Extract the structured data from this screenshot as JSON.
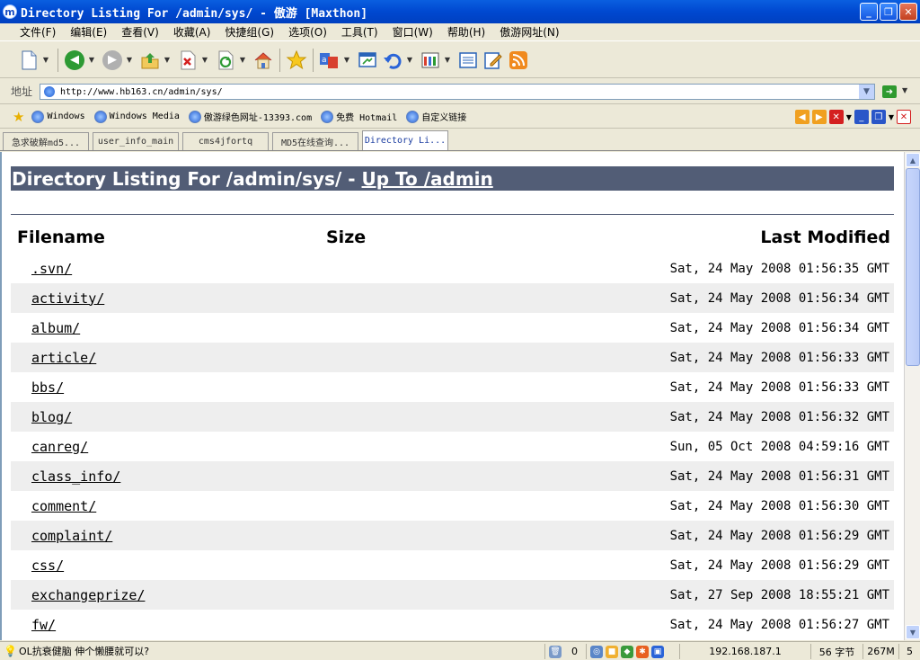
{
  "window": {
    "title": "Directory Listing For /admin/sys/ - 傲游 [Maxthon]",
    "app_icon_letter": "m",
    "minimize": "_",
    "maximize": "❐",
    "close": "✕"
  },
  "menu": [
    "文件(F)",
    "编辑(E)",
    "查看(V)",
    "收藏(A)",
    "快捷组(G)",
    "选项(O)",
    "工具(T)",
    "窗口(W)",
    "帮助(H)",
    "傲游网址(N)"
  ],
  "address": {
    "label": "地址",
    "url": "http://www.hb163.cn/admin/sys/"
  },
  "favorites": [
    "Windows",
    "Windows Media",
    "傲游绿色网址-13393.com",
    "免费 Hotmail",
    "自定义链接"
  ],
  "tabs": [
    "急求破解md5...",
    "user_info_main",
    "cms4jfortq",
    "MD5在线查询...",
    "Directory Li..."
  ],
  "active_tab": 4,
  "page": {
    "heading_prefix": "Directory Listing For /admin/sys/ - ",
    "heading_link": "Up To /admin",
    "col_filename": "Filename",
    "col_size": "Size",
    "col_modified": "Last Modified",
    "files": [
      {
        "name": ".svn/",
        "modified": "Sat, 24 May 2008 01:56:35 GMT"
      },
      {
        "name": "activity/",
        "modified": "Sat, 24 May 2008 01:56:34 GMT"
      },
      {
        "name": "album/",
        "modified": "Sat, 24 May 2008 01:56:34 GMT"
      },
      {
        "name": "article/",
        "modified": "Sat, 24 May 2008 01:56:33 GMT"
      },
      {
        "name": "bbs/",
        "modified": "Sat, 24 May 2008 01:56:33 GMT"
      },
      {
        "name": "blog/",
        "modified": "Sat, 24 May 2008 01:56:32 GMT"
      },
      {
        "name": "canreg/",
        "modified": "Sun, 05 Oct 2008 04:59:16 GMT"
      },
      {
        "name": "class_info/",
        "modified": "Sat, 24 May 2008 01:56:31 GMT"
      },
      {
        "name": "comment/",
        "modified": "Sat, 24 May 2008 01:56:30 GMT"
      },
      {
        "name": "complaint/",
        "modified": "Sat, 24 May 2008 01:56:29 GMT"
      },
      {
        "name": "css/",
        "modified": "Sat, 24 May 2008 01:56:29 GMT"
      },
      {
        "name": "exchangeprize/",
        "modified": "Sat, 27 Sep 2008 18:55:21 GMT"
      },
      {
        "name": "fw/",
        "modified": "Sat, 24 May 2008 01:56:27 GMT"
      }
    ]
  },
  "status": {
    "message": "OL抗衰健脑 伸个懒腰就可以?",
    "count": "0",
    "ip": "192.168.187.1",
    "bytes": "56 字节",
    "memory": "267M",
    "last": "5"
  },
  "colors": {
    "heading_bg": "#525D76",
    "row_alt": "#EEEEEE",
    "titlebar": "#0048D0"
  }
}
